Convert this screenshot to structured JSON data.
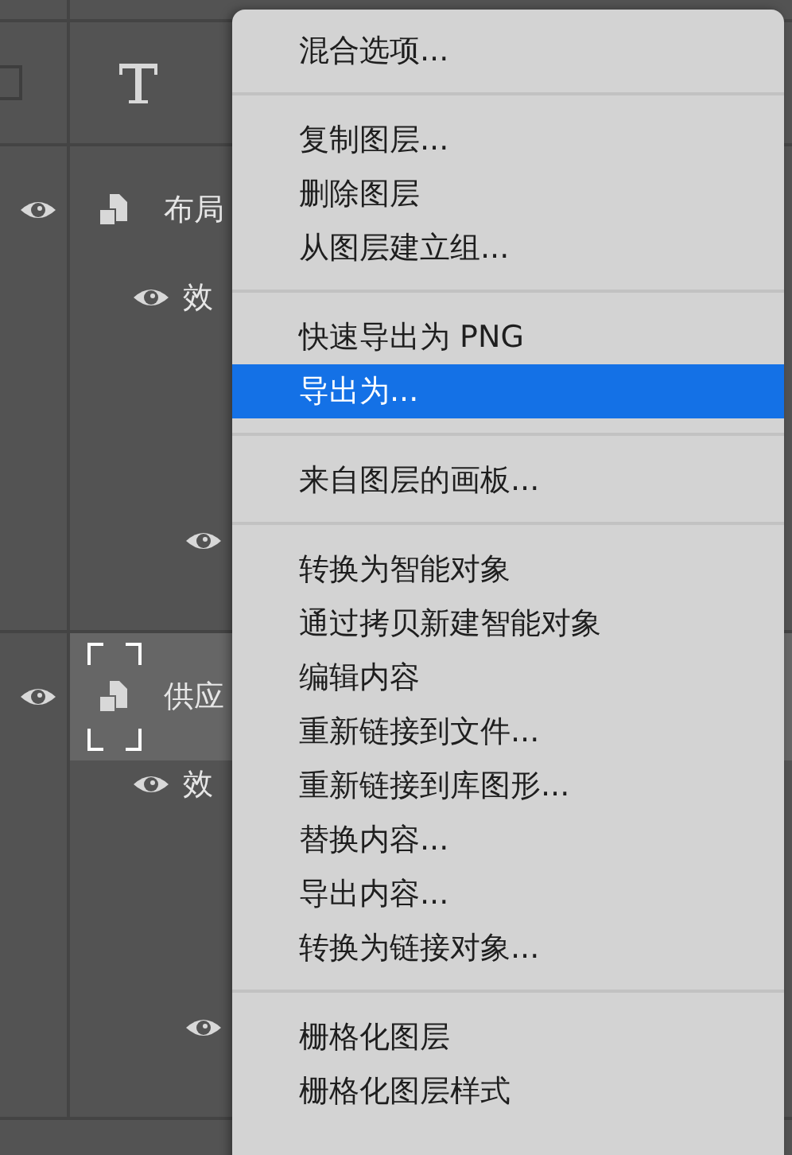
{
  "layers_panel": {
    "rows": [
      {
        "kind": "text_layer",
        "visible": false,
        "selected": false
      },
      {
        "kind": "smart_object",
        "name": "布局",
        "visible": true,
        "selected": false,
        "children": [
          {
            "kind": "effects",
            "name": "效",
            "visible": true
          },
          {
            "kind": "effect",
            "visible": true
          }
        ]
      },
      {
        "kind": "smart_object",
        "name": "供应",
        "visible": true,
        "selected": true,
        "children": [
          {
            "kind": "effects",
            "name": "效",
            "visible": true
          },
          {
            "kind": "effect",
            "visible": true
          }
        ]
      }
    ]
  },
  "context_menu": {
    "groups": [
      [
        {
          "label": "混合选项...",
          "selected": false
        }
      ],
      [
        {
          "label": "复制图层...",
          "selected": false
        },
        {
          "label": "删除图层",
          "selected": false
        },
        {
          "label": "从图层建立组...",
          "selected": false
        }
      ],
      [
        {
          "label": "快速导出为 PNG",
          "selected": false
        },
        {
          "label": "导出为...",
          "selected": true
        }
      ],
      [
        {
          "label": "来自图层的画板...",
          "selected": false
        }
      ],
      [
        {
          "label": "转换为智能对象",
          "selected": false
        },
        {
          "label": "通过拷贝新建智能对象",
          "selected": false
        },
        {
          "label": "编辑内容",
          "selected": false
        },
        {
          "label": "重新链接到文件...",
          "selected": false
        },
        {
          "label": "重新链接到库图形...",
          "selected": false
        },
        {
          "label": "替换内容...",
          "selected": false
        },
        {
          "label": "导出内容...",
          "selected": false
        },
        {
          "label": "转换为链接对象...",
          "selected": false
        }
      ],
      [
        {
          "label": "栅格化图层",
          "selected": false
        },
        {
          "label": "栅格化图层样式",
          "selected": false
        }
      ]
    ]
  }
}
